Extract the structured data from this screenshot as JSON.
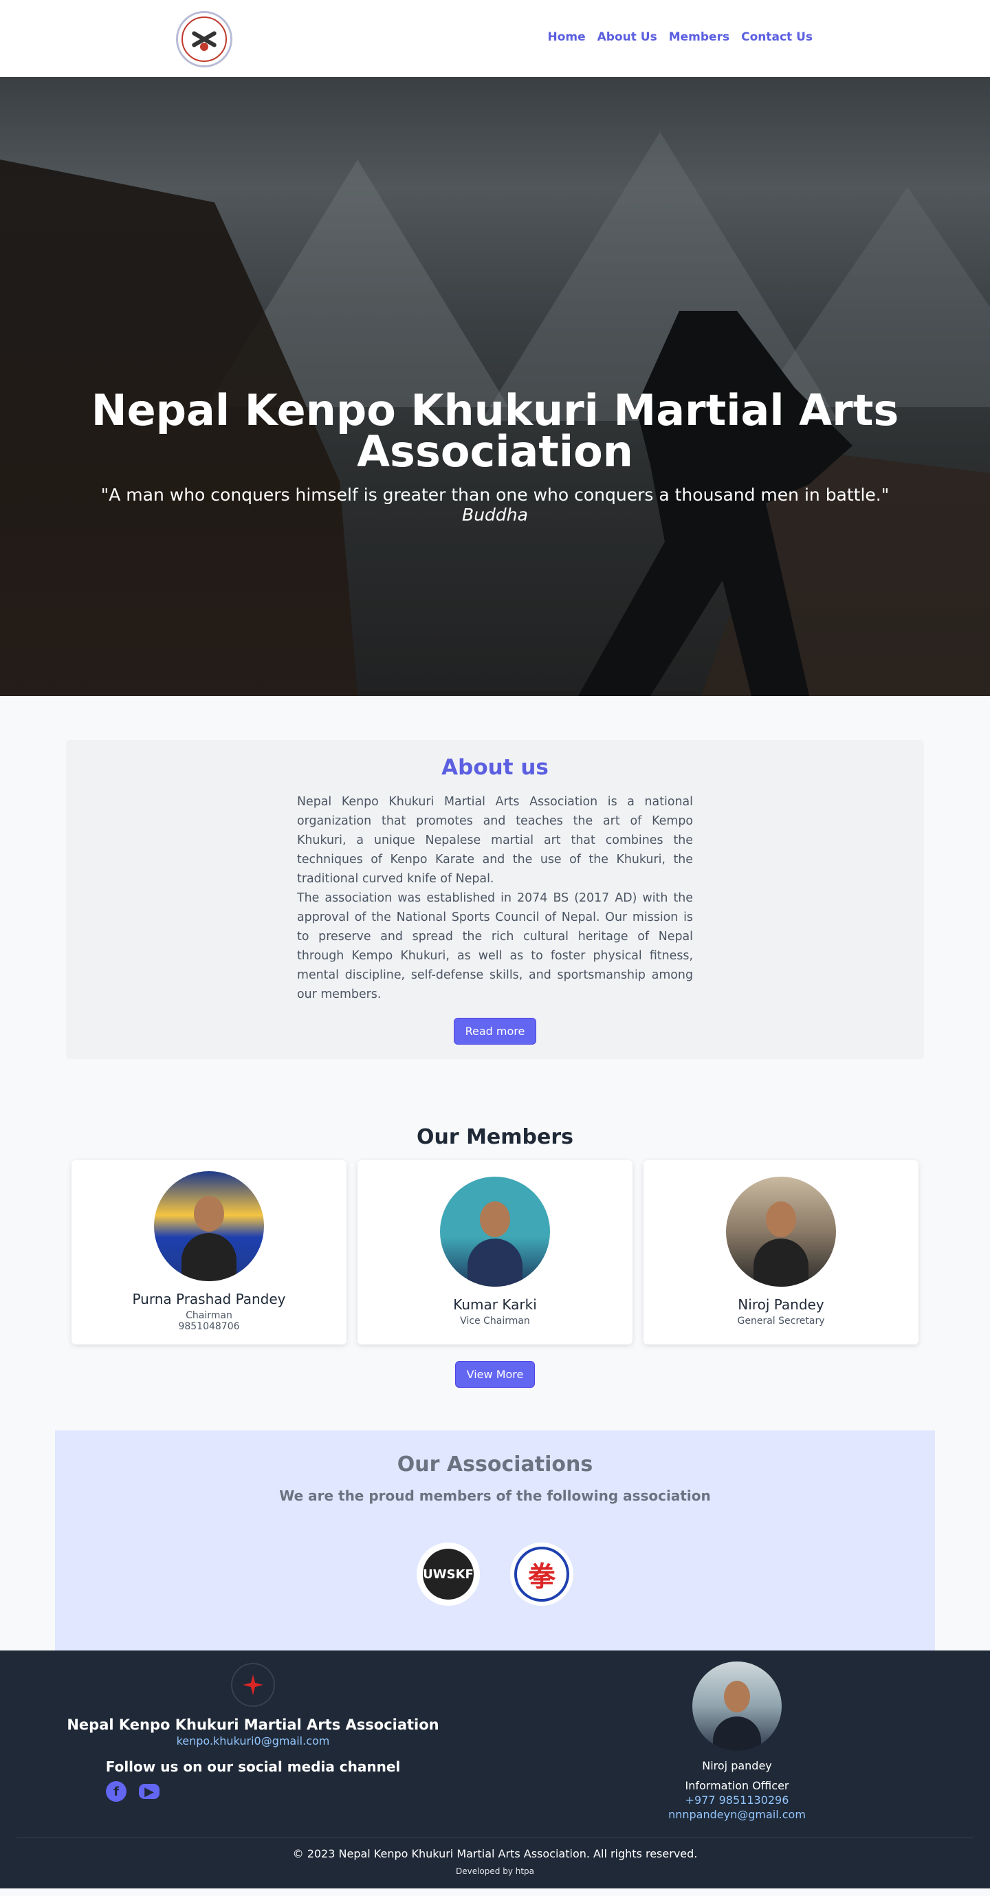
{
  "nav": {
    "links": [
      "Home",
      "About Us",
      "Members",
      "Contact Us"
    ]
  },
  "hero": {
    "title": "Nepal Kenpo Khukuri Martial Arts Association",
    "quote": "\"A man who conquers himself is greater than one who conquers a thousand men in battle.\"",
    "author": "Buddha"
  },
  "about": {
    "heading": "About us",
    "paragraphs": [
      "Nepal Kenpo Khukuri Martial Arts Association is a national organization that promotes and teaches the art of Kempo Khukuri, a unique Nepalese martial art that combines the techniques of Kenpo Karate and the use of the Khukuri, the traditional curved knife of Nepal.",
      "The association was established in 2074 BS (2017 AD) with the approval of the National Sports Council of Nepal. Our mission is to preserve and spread the rich cultural heritage of Nepal through Kempo Khukuri, as well as to foster physical fitness, mental discipline, self-defense skills, and sportsmanship among our members."
    ],
    "button": "Read more"
  },
  "members": {
    "heading": "Our Members",
    "list": [
      {
        "name": "Purna Prashad Pandey",
        "role": "Chairman",
        "phone": "9851048706"
      },
      {
        "name": "Kumar Karki",
        "role": "Vice Chairman",
        "phone": ""
      },
      {
        "name": "Niroj Pandey",
        "role": "General Secretary",
        "phone": ""
      }
    ],
    "button": "View More"
  },
  "associations": {
    "heading": "Our Associations",
    "subheading": "We are the proud members of the following association",
    "logos": [
      {
        "text": "UWSKF",
        "icon": "uwskf-logo"
      },
      {
        "text": "拳",
        "icon": "international-kempo-federation-logo"
      }
    ]
  },
  "footer": {
    "org": "Nepal Kenpo Khukuri Martial Arts Association",
    "email": "kenpo.khukuri0@gmail.com",
    "follow": "Follow us on our social media channel",
    "social": [
      {
        "icon": "facebook-icon",
        "glyph": "f"
      },
      {
        "icon": "youtube-icon",
        "glyph": "▶"
      }
    ],
    "officer": {
      "name": "Niroj pandey",
      "role": "Information Officer",
      "phone": "+977 9851130296",
      "email": "nnnpandeyn@gmail.com"
    },
    "copyright": "© 2023 Nepal Kenpo Khukuri Martial Arts Association. All rights reserved.",
    "developer": "Developed by htpa"
  }
}
